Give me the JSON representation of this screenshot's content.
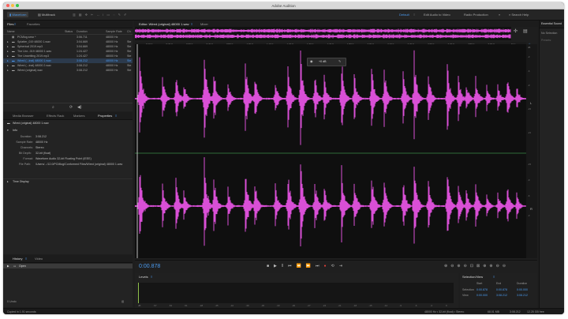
{
  "app": {
    "title": "Adobe Audition"
  },
  "toolbar": {
    "waveform_label": "Waveform",
    "multitrack_label": "Multitrack",
    "workspaces": [
      "Default",
      "Edit Audio to Video",
      "Radio Production"
    ],
    "overflow": "»",
    "search_placeholder": "Search Help"
  },
  "files_panel": {
    "tabs": [
      "Files",
      "Favorites"
    ],
    "columns": [
      "Name",
      "Status",
      "Duration",
      "Sample Rate",
      "Ch"
    ],
    "rows": [
      {
        "name": "PCMlog.sesx *",
        "duration": "3:06.711",
        "rate": "48000 Hz",
        "ch": "",
        "selected": false
      },
      {
        "name": "Splatter_019 48000 1.wav",
        "duration": "3:04.669",
        "rate": "48000 Hz",
        "ch": "Ste",
        "selected": false
      },
      {
        "name": "Spherical 2019.mp3",
        "duration": "3:04.669",
        "rate": "48000 Hz",
        "ch": "Ste",
        "selected": false
      },
      {
        "name": "The Unr...019 48000 1.wav",
        "duration": "1:24.427",
        "rate": "48000 Hz",
        "ch": "Ste",
        "selected": false
      },
      {
        "name": "The Unsettling 2019.mp3",
        "duration": "1:24.427",
        "rate": "48000 Hz",
        "ch": "Ste",
        "selected": false
      },
      {
        "name": "Wired (...inal) 48000 1.wav",
        "duration": "3:08.212",
        "rate": "48000 Hz",
        "ch": "Ste",
        "selected": true
      },
      {
        "name": "Wired (...inal) 48000 2.wav",
        "duration": "3:08.212",
        "rate": "48000 Hz",
        "ch": "Ste",
        "selected": false
      },
      {
        "name": "Wired (original).wav",
        "duration": "3:08.212",
        "rate": "48000 Hz",
        "ch": "Ste",
        "selected": false
      }
    ]
  },
  "props_panel": {
    "tabs": [
      "Media Browser",
      "Effects Rack",
      "Markers",
      "Properties"
    ],
    "file": "Wired (original) 48000 1.wav",
    "info_label": "Info",
    "info": [
      {
        "k": "Duration:",
        "v": "3:08.212"
      },
      {
        "k": "Sample Rate:",
        "v": "48000 Hz"
      },
      {
        "k": "Channels:",
        "v": "Stereo"
      },
      {
        "k": "Bit Depth:",
        "v": "32-bit (float)"
      },
      {
        "k": "Format:",
        "v": "Waveform Audio 32-bit Floating Point (IEEE)"
      },
      {
        "k": "File Path:",
        "v": "/Users/.../12.0/PCMlog/Conformed Files/Wired (original) 48000 1.wav"
      }
    ],
    "time_display_label": "Time Display"
  },
  "history_panel": {
    "tabs": [
      "History",
      "Video"
    ],
    "items": [
      "Open"
    ],
    "undo": "0 Undo"
  },
  "editor": {
    "tabs": [
      "Editor: Wired (original) 48000 1.wav",
      "Mixer"
    ],
    "hud_gain": "+0 dB",
    "ruler_unit": "hms",
    "ruler_ticks": [
      "0:10.0",
      "0:20.0",
      "0:30.0",
      "0:40.0",
      "0:50.0",
      "1:00.0",
      "1:10.0",
      "1:20.0",
      "1:30.0",
      "1:40.0",
      "1:50.0",
      "2:00.0",
      "2:10.0",
      "2:20.0",
      "2:30.0",
      "2:40.0",
      "2:50.0",
      "3:00.0"
    ],
    "db_scale": [
      "dB",
      "-3",
      "-6",
      "-9",
      "-15",
      "-21",
      "-15",
      "-9",
      "-6",
      "-3"
    ],
    "channel_labels": [
      "L",
      "R"
    ],
    "timecode": "0:00.878",
    "wave_color": "#d94fd6"
  },
  "levels": {
    "title": "Levels",
    "scale": [
      "dB",
      "-57",
      "-54",
      "-51",
      "-48",
      "-45",
      "-42",
      "-39",
      "-36",
      "-33",
      "-30",
      "-27",
      "-24",
      "-21",
      "-18",
      "-15",
      "-12",
      "-9",
      "-6",
      "-3",
      "0"
    ]
  },
  "selection_view": {
    "title": "Selection/View",
    "headers": [
      "Start",
      "End",
      "Duration"
    ],
    "rows": [
      {
        "label": "Selection",
        "start": "0:00.878",
        "end": "0:00.878",
        "dur": "0:00.000"
      },
      {
        "label": "View",
        "start": "0:00.000",
        "end": "3:08.212",
        "dur": "3:08.212"
      }
    ]
  },
  "essential_sound": {
    "title": "Essential Sound",
    "no_selection": "No Selection",
    "presets": "Presets:"
  },
  "status": {
    "left": "Copied in 1.91 seconds",
    "right": [
      "48000 Hz • 32-bit (float) • Stereo",
      "68.01 MB",
      "3:08.212",
      "12.25 GB free"
    ]
  }
}
